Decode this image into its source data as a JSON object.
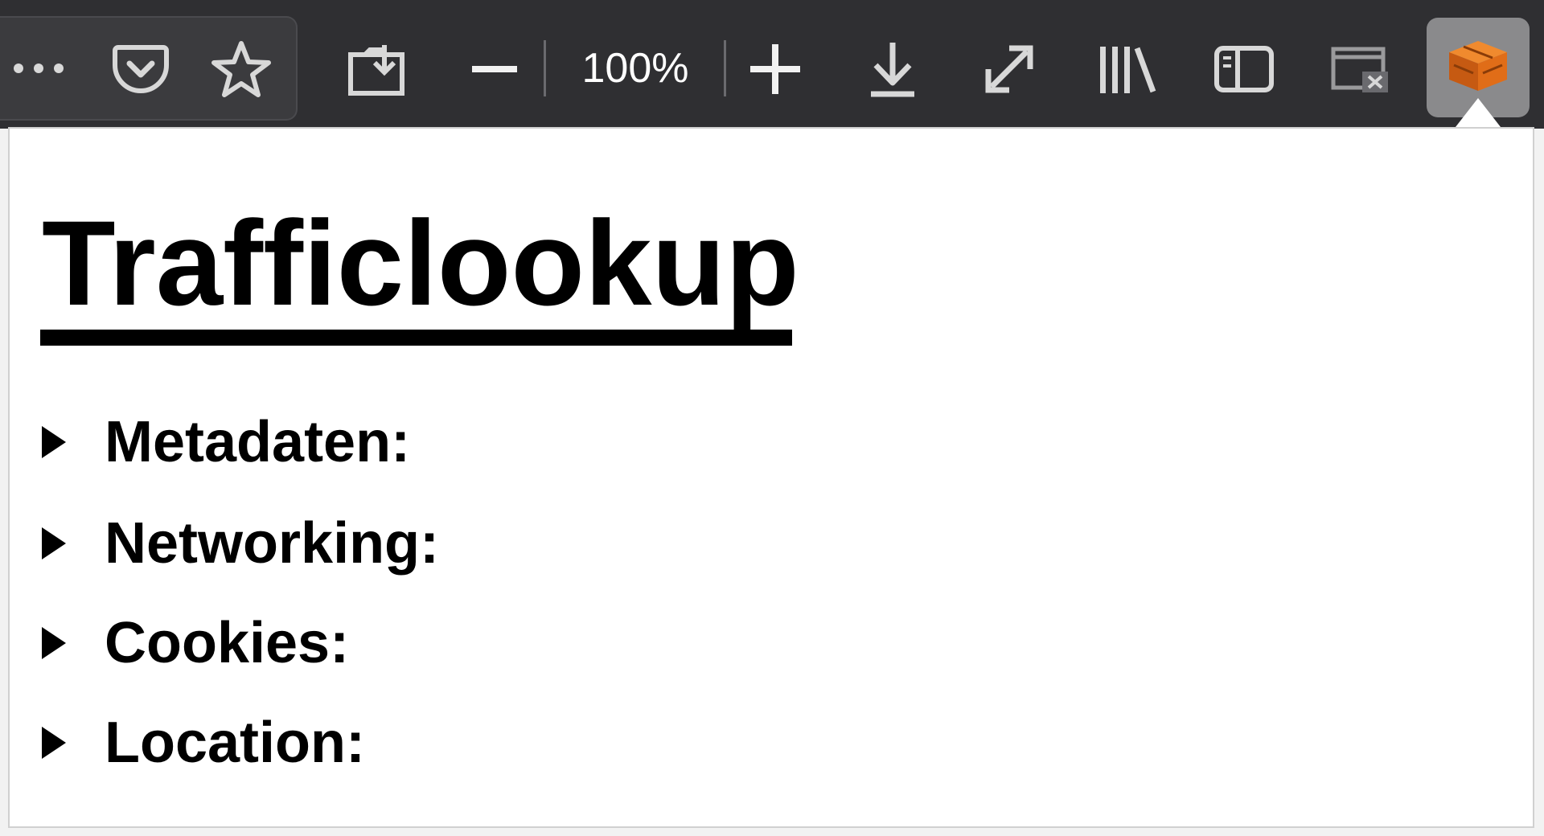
{
  "toolbar": {
    "icons": [
      "page-actions-ellipsis-icon",
      "pocket-icon",
      "bookmark-star-icon",
      "screenshot-icon",
      "zoom-out-icon",
      "zoom-in-icon",
      "downloads-icon",
      "fullscreen-icon",
      "library-icon",
      "sidebar-icon",
      "private-window-icon",
      "trafficlookup-extension-icon"
    ],
    "zoom_level": "100%",
    "colors": {
      "background": "#2f2f32",
      "urlbar": "#3b3b3e",
      "extension_active": "#8a8a8c",
      "extension_icon": "#e8701a"
    }
  },
  "panel": {
    "title": "Trafficlookup",
    "sections": [
      {
        "label": "Metadaten:"
      },
      {
        "label": "Networking:"
      },
      {
        "label": "Cookies:"
      },
      {
        "label": "Location:"
      }
    ]
  }
}
